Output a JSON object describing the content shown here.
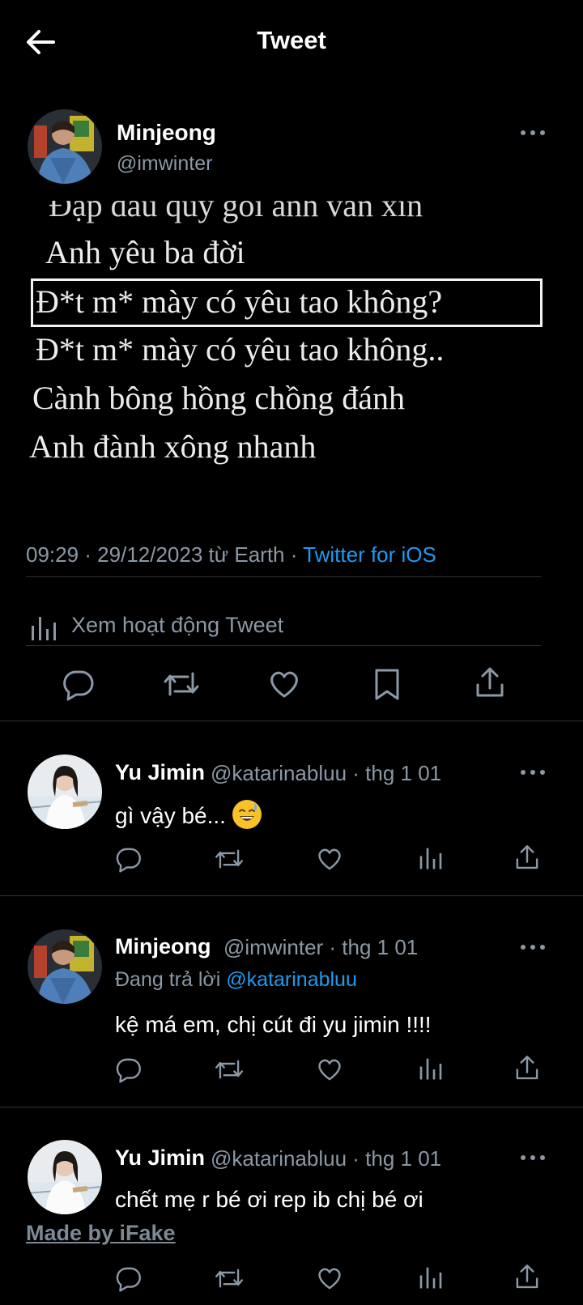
{
  "header": {
    "title": "Tweet"
  },
  "main_tweet": {
    "name": "Minjeong",
    "handle": "@imwinter",
    "image_lines": [
      "Đập đầu quỳ gối anh vẫn xin",
      "Anh yêu ba đời",
      "Đ*t m* mày có yêu tao không?",
      "Đ*t m* mày có yêu tao không..",
      "Cành bông hồng chồng đánh",
      "Anh đành xông nhanh"
    ],
    "time_date_place": "09:29 · 29/12/2023 từ Earth · ",
    "source": "Twitter for iOS",
    "activity_label": "Xem hoạt động Tweet"
  },
  "replies": [
    {
      "name": "Yu Jimin",
      "handle": "@katarinabluu · thg 1 01",
      "text": "gì vậy bé...",
      "emoji": "sweat-smile-emoji"
    },
    {
      "name": "Minjeong",
      "handle": "@imwinter · thg 1 01",
      "replying_prefix": "Đang trả lời ",
      "replying_to": "@katarinabluu",
      "text": "kệ má em, chị cút đi yu jimin !!!!"
    },
    {
      "name": "Yu Jimin",
      "handle": "@katarinabluu · thg 1 01",
      "text": "chết mẹ r bé ơi rep ib chị bé ơi"
    }
  ],
  "watermark": "Made by iFake",
  "colors": {
    "background": "#000000",
    "secondary_text": "#8b98a5",
    "link": "#1d9bf0",
    "divider": "#2f3336"
  }
}
